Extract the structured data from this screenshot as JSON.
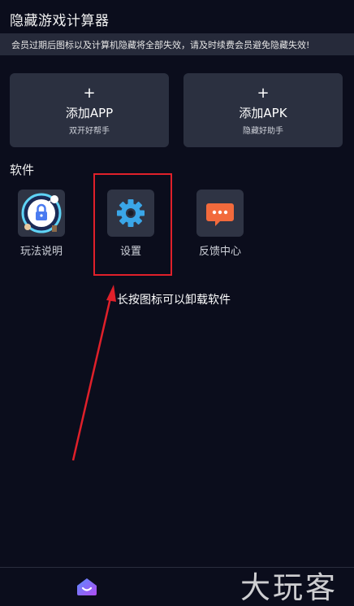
{
  "header": {
    "title": "隐藏游戏计算器"
  },
  "notice": {
    "text": "会员过期后图标以及计算机隐藏将全部失效，请及时续费会员避免隐藏失效!"
  },
  "actions": [
    {
      "plus": "+",
      "label": "添加APP",
      "sub": "双开好帮手"
    },
    {
      "plus": "+",
      "label": "添加APK",
      "sub": "隐藏好助手"
    }
  ],
  "section": {
    "title": "软件"
  },
  "apps": [
    {
      "label": "玩法说明",
      "icon": "guide-lock-icon"
    },
    {
      "label": "设置",
      "icon": "gear-icon"
    },
    {
      "label": "反馈中心",
      "icon": "chat-bubble-icon"
    }
  ],
  "annotation": {
    "hint": "长按图标可以卸载软件",
    "highlight_color": "#e0202a"
  },
  "bottom_nav": {
    "home_icon": "home-icon"
  },
  "watermark": {
    "text": "大玩客"
  },
  "colors": {
    "background": "#0b0d1c",
    "card": "#2b3040",
    "notice_bg": "#262a3a",
    "gear": "#3aa6e8",
    "chat": "#f26a3c",
    "accent_purple": "#7b5cff"
  }
}
